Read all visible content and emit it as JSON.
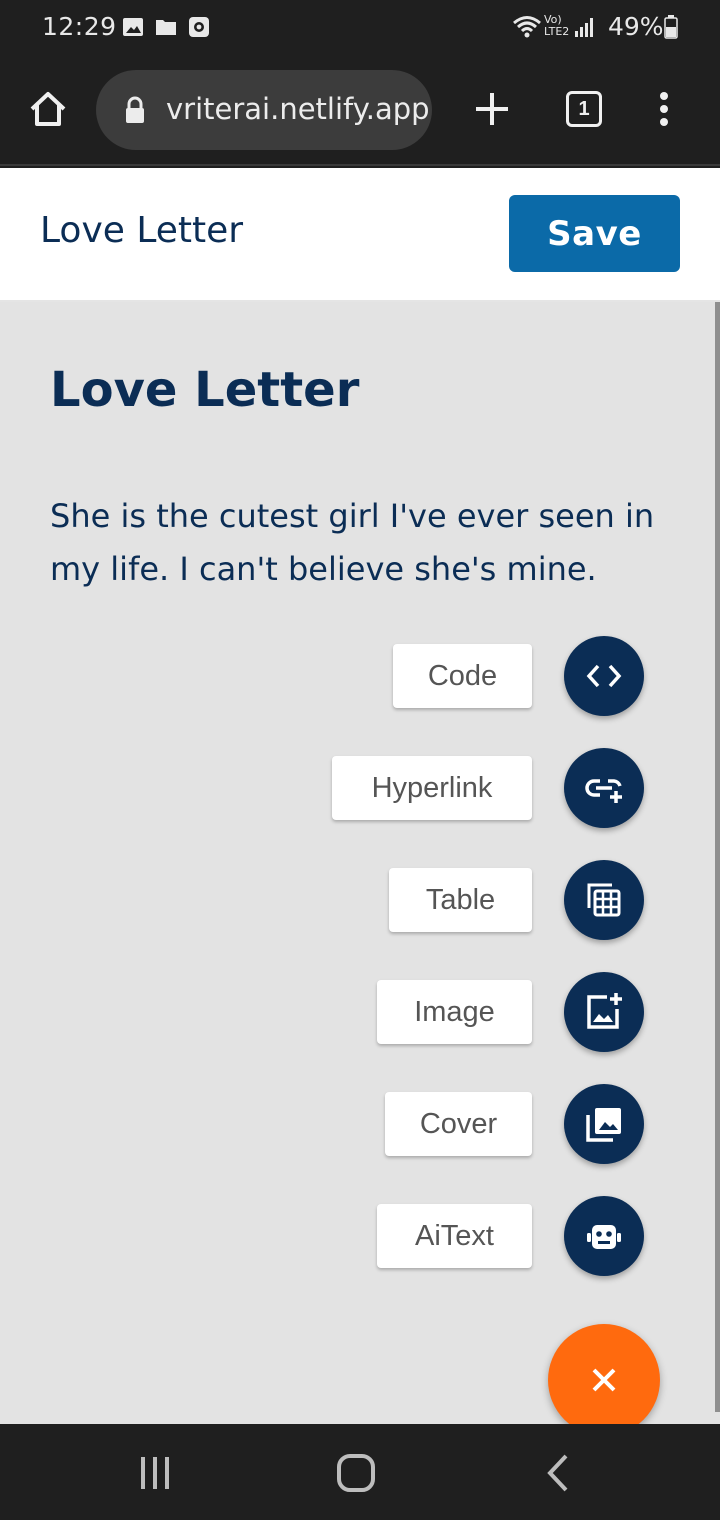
{
  "status_bar": {
    "time": "12:29",
    "battery": "49%",
    "network_label": "Vo) LTE2"
  },
  "browser": {
    "url": "vriterai.netlify.app",
    "tab_count": "1"
  },
  "header": {
    "title": "Love Letter",
    "save_label": "Save"
  },
  "document": {
    "title": "Love Letter",
    "body": "She is the cutest girl I've ever seen in my life. I can't believe she's mine."
  },
  "speed_dial": {
    "actions": [
      {
        "label": "Code",
        "icon": "code-icon"
      },
      {
        "label": "Hyperlink",
        "icon": "add-link-icon"
      },
      {
        "label": "Table",
        "icon": "table-icon"
      },
      {
        "label": "Image",
        "icon": "add-image-icon"
      },
      {
        "label": "Cover",
        "icon": "photo-library-icon"
      },
      {
        "label": "AiText",
        "icon": "robot-icon"
      }
    ],
    "close_icon": "close-icon"
  },
  "colors": {
    "primary": "#0b2d55",
    "save_button": "#0b6aa8",
    "fab": "#ff6a0e",
    "content_bg": "#e3e3e3"
  }
}
